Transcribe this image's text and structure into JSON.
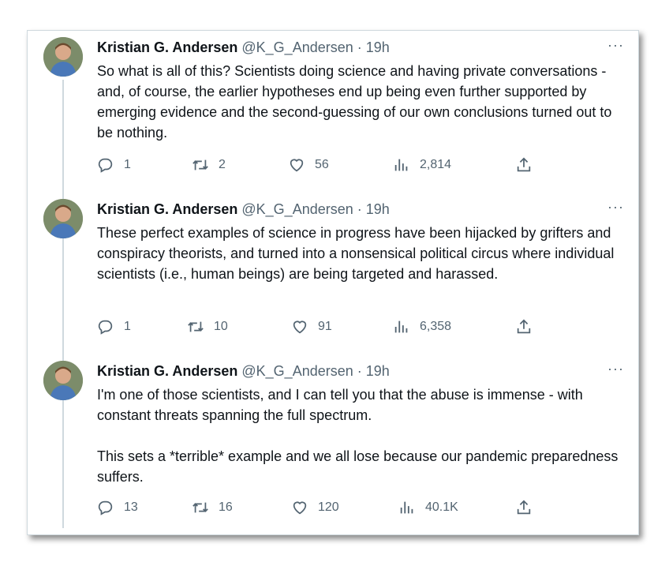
{
  "tweets": [
    {
      "author": "Kristian G. Andersen",
      "handle": "@K_G_Andersen",
      "separator": "·",
      "time": "19h",
      "more": "···",
      "text": [
        "So what is all of this? Scientists doing science and having private conversations - and, of course, the earlier hypotheses end up being even further supported by emerging evidence and the second-guessing of our own conclusions turned out to be nothing."
      ],
      "replies": "1",
      "retweets": "2",
      "likes": "56",
      "views": "2,814"
    },
    {
      "author": "Kristian G. Andersen",
      "handle": "@K_G_Andersen",
      "separator": "·",
      "time": "19h",
      "more": "···",
      "text": [
        "These perfect examples of science in progress have been hijacked by grifters and conspiracy theorists, and turned into a nonsensical political circus where individual scientists (i.e., human beings) are being targeted and harassed."
      ],
      "replies": "1",
      "retweets": "10",
      "likes": "91",
      "views": "6,358"
    },
    {
      "author": "Kristian G. Andersen",
      "handle": "@K_G_Andersen",
      "separator": "·",
      "time": "19h",
      "more": "···",
      "text": [
        "I'm one of those scientists, and I can tell you that the abuse is immense - with constant threats spanning the full spectrum.",
        "This sets a *terrible* example and we all lose because our pandemic preparedness suffers."
      ],
      "replies": "13",
      "retweets": "16",
      "likes": "120",
      "views": "40.1K"
    }
  ],
  "colors": {
    "text": "#0f1419",
    "secondary": "#536471",
    "thread_line": "#cfd9de"
  },
  "icons": [
    "reply-icon",
    "retweet-icon",
    "like-icon",
    "views-icon",
    "share-icon"
  ]
}
